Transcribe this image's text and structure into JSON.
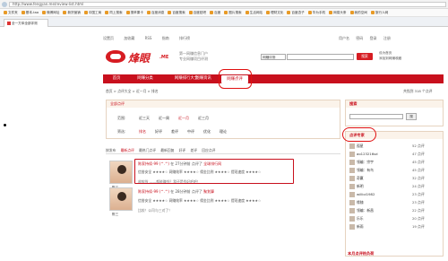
{
  "browser": {
    "url": "http://www.fengyan.me/review-list.html",
    "favorites": [
      "文件夹",
      "基本-taa",
      "微博网址",
      "新货营销",
      "中国工商",
      "同上搜索",
      "搜苹果卡",
      "百度消息",
      "百度搜索",
      "百度贴吧",
      "百度",
      "图片搜索",
      "生活网站",
      "理财文化",
      "百度杏子",
      "华为手机",
      "网易头条",
      "我的空间",
      "旅行人网"
    ],
    "tab_title": "全一方体全部评测"
  },
  "site": {
    "top_nav": [
      "设置页",
      "加收藏",
      "RSS",
      "指南",
      "排行榜"
    ],
    "top_links": [
      "用户名",
      "密码",
      "登录",
      "注册"
    ],
    "logo_text": "烽眼",
    "logo_suffix": ".ME",
    "slogan1": "第一网赚信息门户",
    "slogan2": "专业网赚项目评测",
    "search_select": "网赚评测",
    "search_button": "搜索",
    "fav_link1": "设为首页",
    "fav_link2": "添加到网赚收藏",
    "main_nav": [
      "首页",
      "网赚分类",
      "网赚排行大全",
      "网赚资讯",
      "网赚点评"
    ],
    "breadcrumb": "首页 > 点评大全 > 近一月 > 排名",
    "total": "共找到 318 个点评"
  },
  "filter": {
    "title": "全部点评",
    "row1_label": "范围:",
    "row1_opts": [
      "近三天",
      "近一周",
      "近一月",
      "近三月"
    ],
    "row2_label": "筛选:",
    "row2_opts": [
      "排名",
      "好评",
      "差评",
      "中评",
      "优化",
      "理论"
    ],
    "list_header": [
      "按发布",
      "最新点评",
      "最热门点评",
      "最新回复",
      "好评",
      "差评",
      "回应点评"
    ]
  },
  "items": [
    {
      "user": "陈三",
      "line1_user": "陈家持续-99 (^.^)",
      "line1_time": "在 27分钟前 点评了",
      "line1_target": "全球排行网",
      "line2": "信誉安全 ★★★★☆ 网赚效率 ★★★★☆ 佣金比例 ★★★★☆ 提现速度 ★★★★☆",
      "line3": "收款啦 ——都能赚钱？我还是找好吧吧！"
    },
    {
      "user": "陈三",
      "line1_user": "陈家持续-99 (^.^)",
      "line1_time": "在 28分钟前 点评了",
      "line1_target": "聚划算",
      "line2": "信誉安全 ★★★★☆ 网赚效率 ★★★★☆ 佣金比例 ★★★★☆ 提现速度 ★★★★☆",
      "line3": "比较！公司与三对了！"
    }
  ],
  "sidebar": {
    "search_title": "搜索",
    "search_button": "搜",
    "experts_title": "点评专家",
    "experts": [
      {
        "name": "孤星",
        "count": "52 点评"
      },
      {
        "name": "ao123216sd",
        "count": "47 点评"
      },
      {
        "name": "领编：宗宇",
        "count": "45 点评"
      },
      {
        "name": "领编：有鸟",
        "count": "45 点评"
      },
      {
        "name": "奇赢",
        "count": "32 点评"
      },
      {
        "name": "新明",
        "count": "24 点评"
      },
      {
        "name": "williol1982",
        "count": "23 点评"
      },
      {
        "name": "缘随",
        "count": "23 点评"
      },
      {
        "name": "领编：新昌",
        "count": "22 点评"
      },
      {
        "name": "乐乐",
        "count": "20 点评"
      },
      {
        "name": "新雨",
        "count": "19 点评"
      }
    ],
    "more_title": "本月点评热负荷"
  }
}
